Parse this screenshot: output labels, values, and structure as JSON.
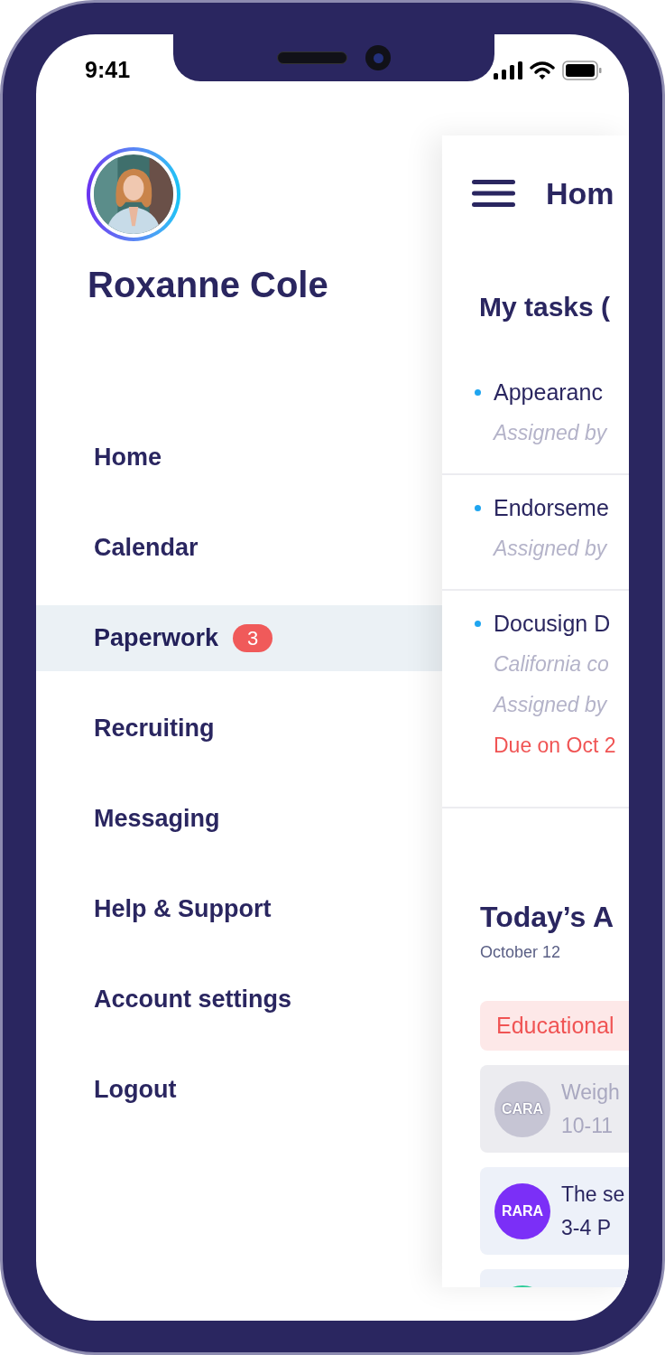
{
  "status_bar": {
    "time": "9:41"
  },
  "profile": {
    "name": "Roxanne Cole"
  },
  "menu": [
    {
      "label": "Home",
      "selected": false
    },
    {
      "label": "Calendar",
      "selected": false
    },
    {
      "label": "Paperwork",
      "selected": true,
      "badge": "3"
    },
    {
      "label": "Recruiting",
      "selected": false
    },
    {
      "label": "Messaging",
      "selected": false
    },
    {
      "label": "Help & Support",
      "selected": false
    },
    {
      "label": "Account settings",
      "selected": false
    },
    {
      "label": "Logout",
      "selected": false
    }
  ],
  "home_panel": {
    "title": "Hom",
    "tasks_heading": "My tasks (",
    "tasks": [
      {
        "title": "Appearanc",
        "lines": [
          {
            "kind": "meta",
            "text": "Assigned by"
          }
        ]
      },
      {
        "title": "Endorseme",
        "lines": [
          {
            "kind": "meta",
            "text": "Assigned by"
          }
        ]
      },
      {
        "title": "Docusign D",
        "lines": [
          {
            "kind": "meta",
            "text": "California co"
          },
          {
            "kind": "meta",
            "text": "Assigned by"
          },
          {
            "kind": "due",
            "text": "Due on Oct 2"
          }
        ]
      }
    ],
    "agenda": {
      "title": "Today’s A",
      "date": "October 12",
      "events": [
        {
          "kind": "tag",
          "title": "Educational"
        },
        {
          "kind": "event",
          "avatar": "CARA",
          "color": "#c6c5d4",
          "title": "Weigh",
          "time": "10-11",
          "dimmed": true
        },
        {
          "kind": "event",
          "avatar": "RARA",
          "color": "#7b2ff7",
          "title": "The se",
          "time": "3-4 P",
          "dimmed": false
        },
        {
          "kind": "event",
          "color": "#2ecc9a"
        }
      ]
    }
  }
}
